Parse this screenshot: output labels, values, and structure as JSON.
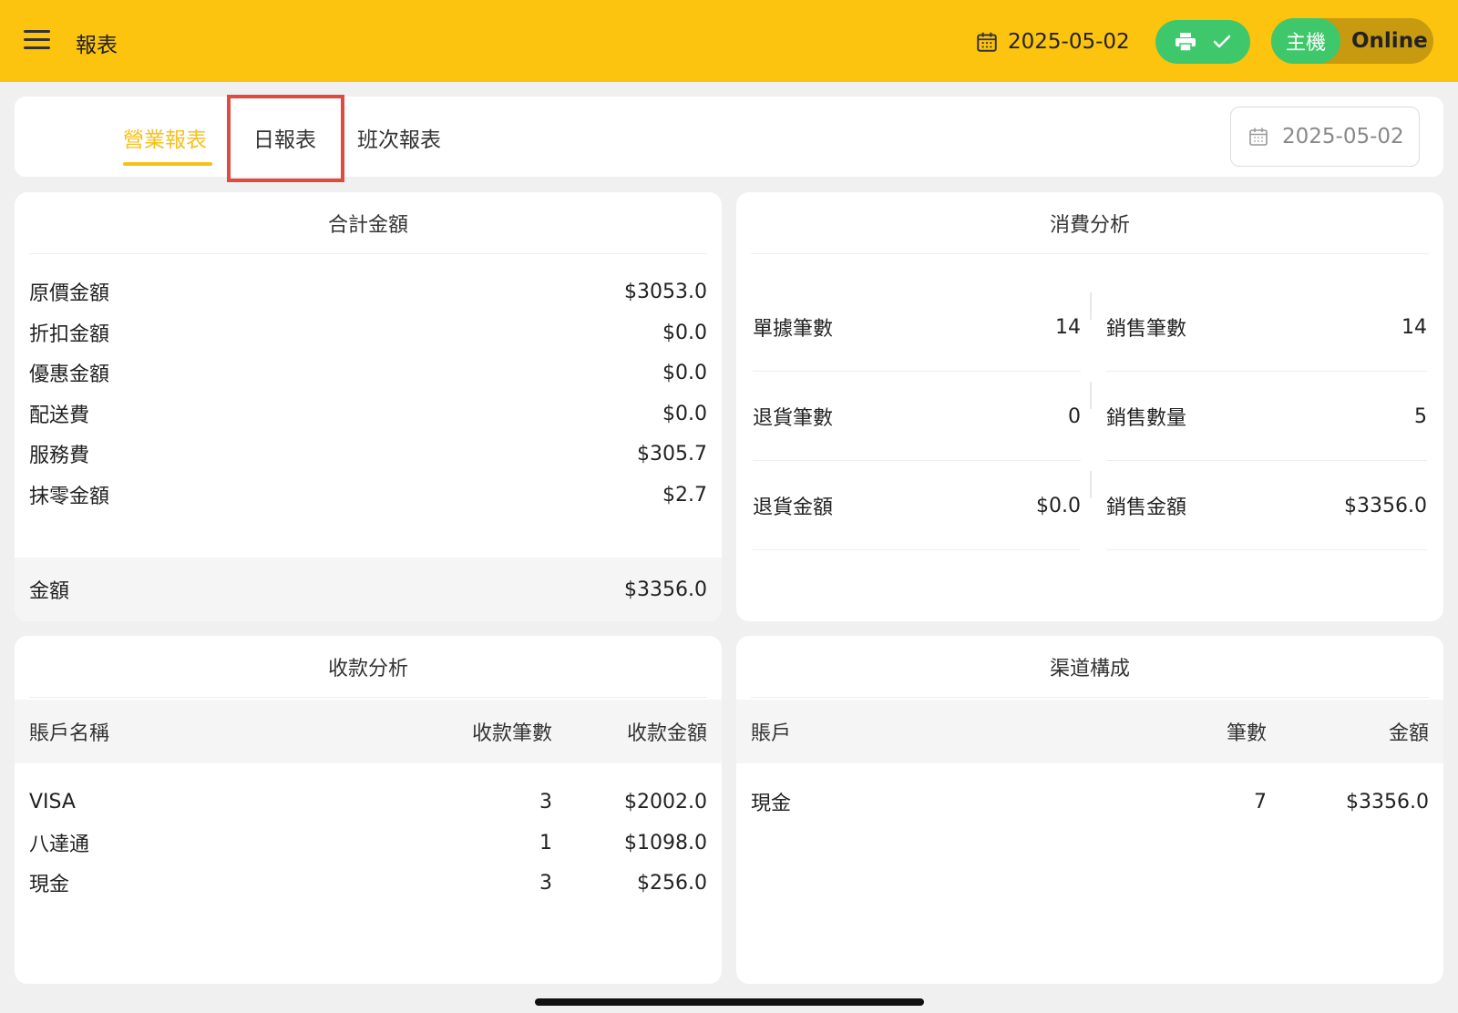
{
  "topbar": {
    "title": "報表",
    "date": "2025-05-02",
    "host_label": "主機",
    "status": "Online"
  },
  "tabs": [
    {
      "label": "營業報表",
      "active": true
    },
    {
      "label": "日報表",
      "active": false
    },
    {
      "label": "班次報表",
      "active": false
    }
  ],
  "filter": {
    "date": "2025-05-02"
  },
  "totals": {
    "title": "合計金額",
    "rows": [
      {
        "label": "原價金額",
        "value": "$3053.0"
      },
      {
        "label": "折扣金額",
        "value": "$0.0"
      },
      {
        "label": "優惠金額",
        "value": "$0.0"
      },
      {
        "label": "配送費",
        "value": "$0.0"
      },
      {
        "label": "服務費",
        "value": "$305.7"
      },
      {
        "label": "抹零金額",
        "value": "$2.7"
      }
    ],
    "total_label": "金額",
    "total_value": "$3356.0"
  },
  "consumption": {
    "title": "消費分析",
    "left": [
      {
        "label": "單據筆數",
        "value": "14"
      },
      {
        "label": "退貨筆數",
        "value": "0"
      },
      {
        "label": "退貨金額",
        "value": "$0.0"
      }
    ],
    "right": [
      {
        "label": "銷售筆數",
        "value": "14"
      },
      {
        "label": "銷售數量",
        "value": "5"
      },
      {
        "label": "銷售金額",
        "value": "$3356.0"
      }
    ]
  },
  "payments": {
    "title": "收款分析",
    "headers": [
      "賬戶名稱",
      "收款筆數",
      "收款金額"
    ],
    "rows": [
      {
        "name": "VISA",
        "count": "3",
        "amount": "$2002.0"
      },
      {
        "name": "八達通",
        "count": "1",
        "amount": "$1098.0"
      },
      {
        "name": "現金",
        "count": "3",
        "amount": "$256.0"
      }
    ]
  },
  "channels": {
    "title": "渠道構成",
    "headers": [
      "賬戶",
      "筆數",
      "金額"
    ],
    "rows": [
      {
        "name": "現金",
        "count": "7",
        "amount": "$3356.0"
      }
    ]
  },
  "colors": {
    "brand_yellow": "#fcc30f",
    "accent_green": "#3ec86b",
    "highlight_red": "#e04a3f"
  }
}
